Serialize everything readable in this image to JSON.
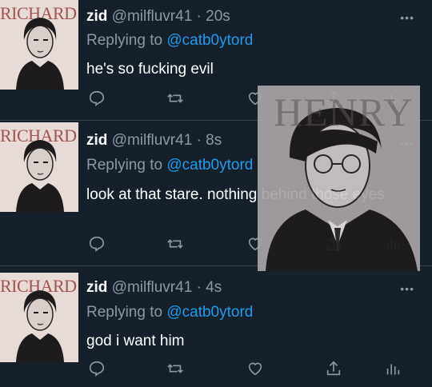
{
  "tweets": [
    {
      "avatar_caption": "RICHARD",
      "name": "zid",
      "meta": "@milfluvr41 · 20s",
      "reply_prefix": "Replying to ",
      "reply_handle": "@catb0ytord",
      "text": "he's so fucking evil",
      "more": "•••"
    },
    {
      "avatar_caption": "RICHARD",
      "name": "zid",
      "meta": "@milfluvr41 · 8s",
      "reply_prefix": "Replying to ",
      "reply_handle": "@catb0ytord",
      "text": "look at that stare. nothing behind those eyes",
      "more": "•••"
    },
    {
      "avatar_caption": "RICHARD",
      "name": "zid",
      "meta": "@milfluvr41 · 4s",
      "reply_prefix": "Replying to ",
      "reply_handle": "@catb0ytord",
      "text": "god i want him",
      "more": "•••"
    }
  ],
  "overlay": {
    "title": "HENRY"
  },
  "colors": {
    "background": "#15202b",
    "link": "#1d9bf0",
    "muted": "#8b98a5",
    "avatar_caption": "#a2544e"
  },
  "icons": [
    "reply-icon",
    "retweet-icon",
    "like-icon",
    "share-icon",
    "analytics-icon",
    "more-icon"
  ]
}
